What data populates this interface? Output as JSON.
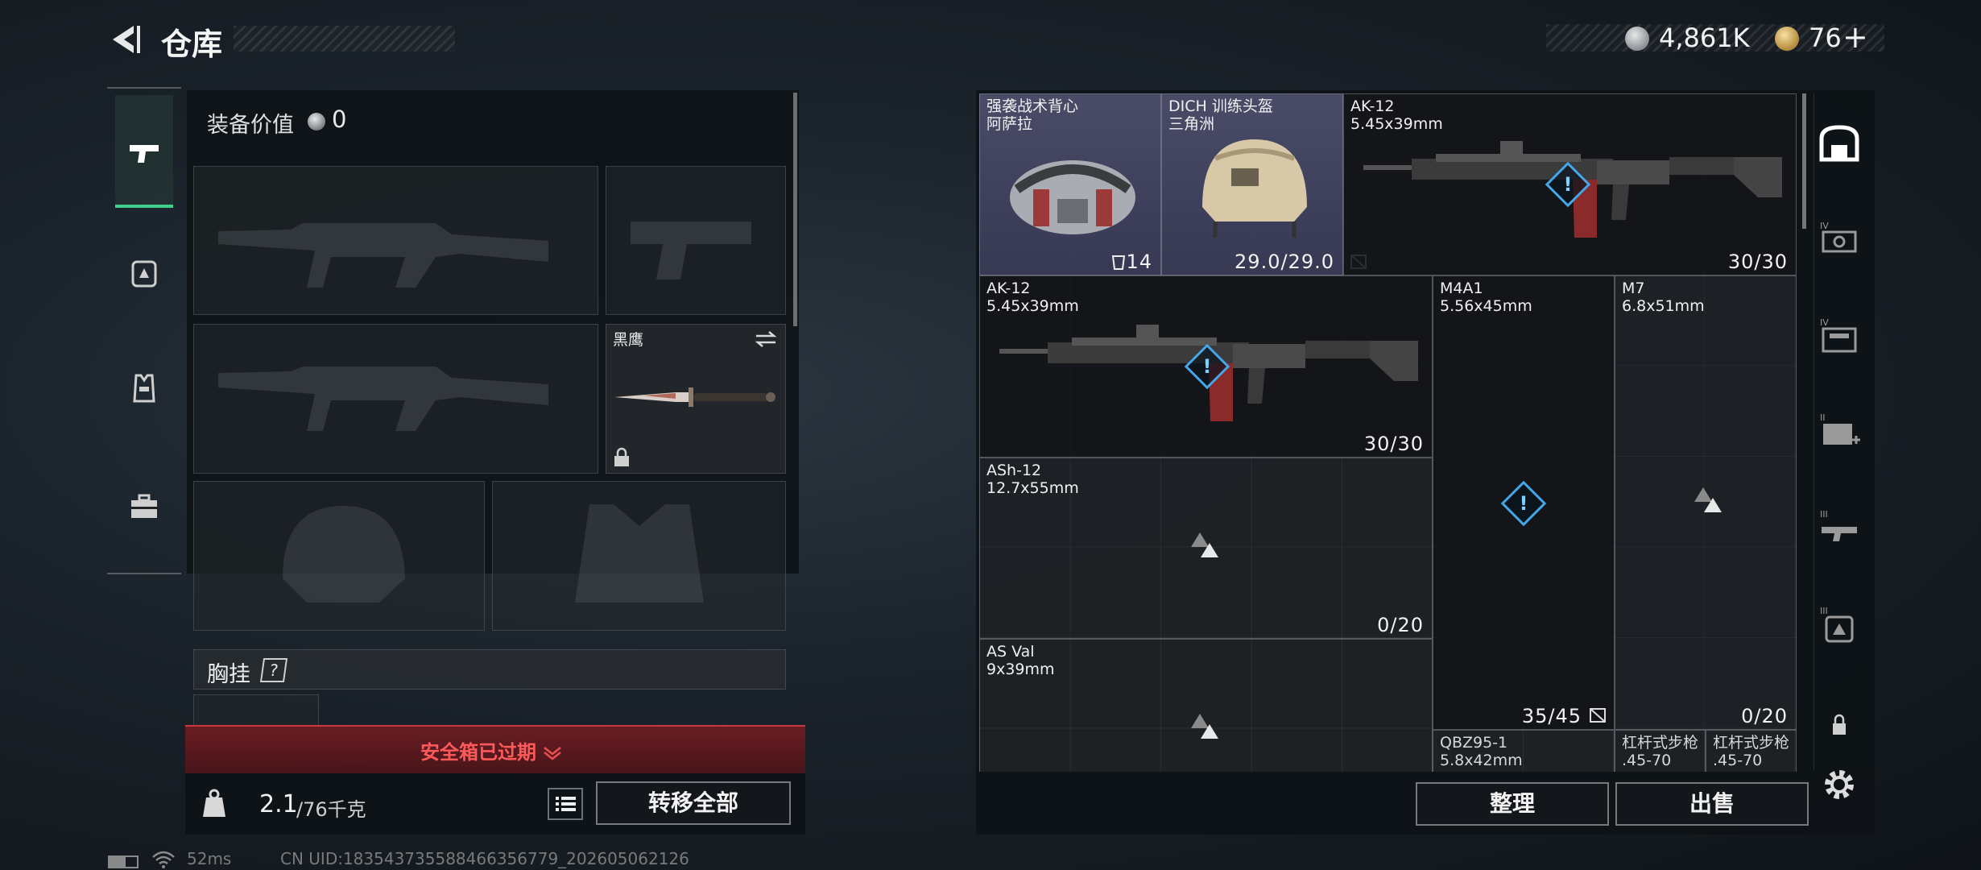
{
  "header": {
    "title": "仓库",
    "currency_silver": "4,861K",
    "currency_gold": "76",
    "gold_plus": "+"
  },
  "loadout": {
    "equip_value_label": "装备价值",
    "equip_value": "0",
    "melee_name": "黑鹰",
    "chest_rig_label": "胸挂",
    "chest_rig_help": "?",
    "safebox_status": "安全箱已过期",
    "weight_current": "2.1",
    "weight_max": "/76千克",
    "transfer_all": "转移全部"
  },
  "stash_items": [
    {
      "name1": "强袭战术背心",
      "name2": "阿萨拉",
      "count": "14"
    },
    {
      "name1": "DICH 训练头盔",
      "name2": "三角洲",
      "count": "29.0/29.0"
    },
    {
      "name1": "AK-12",
      "name2": "5.45x39mm",
      "count": "30/30"
    },
    {
      "name1": "AK-12",
      "name2": "5.45x39mm",
      "count": "30/30"
    },
    {
      "name1": "M4A1",
      "name2": "5.56x45mm",
      "count": "35/45"
    },
    {
      "name1": "M7",
      "name2": "6.8x51mm",
      "count": "0/20"
    },
    {
      "name1": "ASh-12",
      "name2": "12.7x55mm",
      "count": "0/20"
    },
    {
      "name1": "AS Val",
      "name2": "9x39mm",
      "count": ""
    },
    {
      "name1": "QBZ95-1",
      "name2": "5.8x42mm",
      "count": ""
    },
    {
      "name1": "杠杆式步枪",
      "name2": ".45-70",
      "count": ""
    },
    {
      "name1": "杠杆式步枪",
      "name2": ".45-70",
      "count": ""
    }
  ],
  "stash_actions": {
    "sort": "整理",
    "sell": "出售"
  },
  "status_bar": {
    "ping": "52ms",
    "uid": "CN UID:18354373558846635677​9_202605062126"
  },
  "icons": [
    "back-arrow-icon",
    "pistol-icon",
    "backpack-icon",
    "vest-icon",
    "toolbox-icon",
    "warning-icon",
    "lock-icon",
    "swap-icon",
    "list-icon",
    "settings-icon",
    "stash-home-icon"
  ]
}
